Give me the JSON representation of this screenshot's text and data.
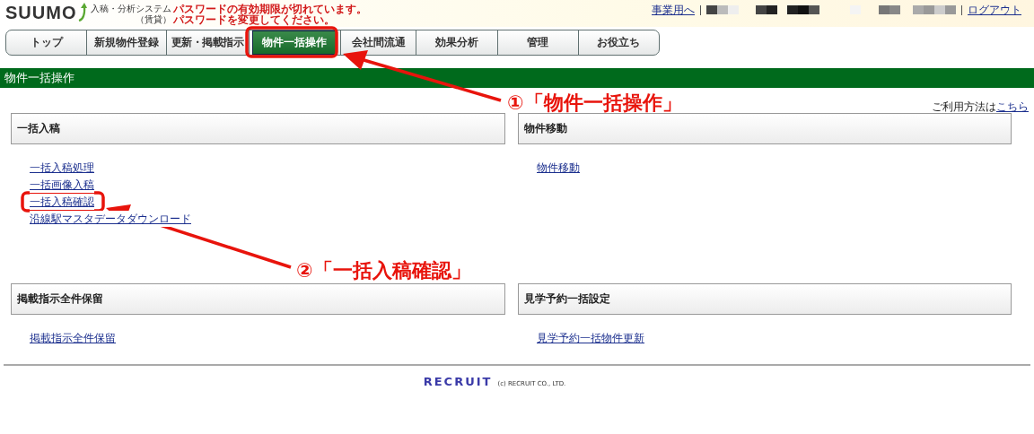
{
  "header": {
    "logo": "SUUMO",
    "system_name": "入稿・分析システム",
    "system_sub": "（賃貸）",
    "alerts": [
      "パスワードの有効期限が切れています。",
      "パスワードを変更してください。"
    ],
    "links": [
      "事業用へ",
      "ログアウト"
    ]
  },
  "nav": [
    {
      "label": "トップ",
      "selected": false
    },
    {
      "label": "新規物件登録",
      "selected": false
    },
    {
      "label": "更新・掲載指示",
      "selected": false
    },
    {
      "label": "物件一括操作",
      "selected": true
    },
    {
      "label": "会社間流通",
      "selected": false
    },
    {
      "label": "効果分析",
      "selected": false
    },
    {
      "label": "管理",
      "selected": false
    },
    {
      "label": "お役立ち",
      "selected": false
    }
  ],
  "page_title": "物件一括操作",
  "help": {
    "text": "ご利用方法は",
    "link": "こちら"
  },
  "panels": [
    {
      "title": "一括入稿",
      "links": [
        "一括入稿処理",
        "一括画像入稿",
        "一括入稿確認",
        "沿線駅マスタデータダウンロード"
      ]
    },
    {
      "title": "物件移動",
      "links": [
        "物件移動"
      ]
    },
    {
      "title": "掲載指示全件保留",
      "links": [
        "掲載指示全件保留"
      ]
    },
    {
      "title": "見学予約一括設定",
      "links": [
        "見学予約一括物件更新"
      ]
    }
  ],
  "footer": {
    "logo": "RECRUIT",
    "copyright": "(c) RECRUIT CO., LTD."
  },
  "annotations": [
    "①「物件一括操作」",
    "②「一括入稿確認」"
  ]
}
